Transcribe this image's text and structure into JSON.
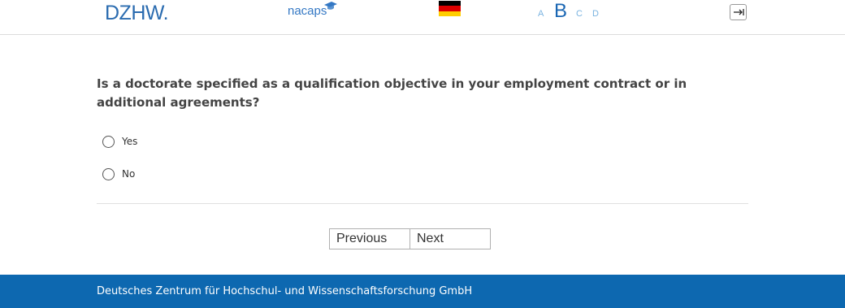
{
  "header": {
    "logo_dzhw": "DZHW.",
    "logo_nacaps": "nacaps",
    "language_flag": "german-flag",
    "font_sizes": [
      "A",
      "B",
      "C",
      "D"
    ],
    "active_font_size": "B",
    "logout_icon": "logout-arrow-icon"
  },
  "question": {
    "text": "Is a doctorate specified as a qualification objective in your employment contract or in additional agreements?",
    "options": [
      {
        "label": "Yes"
      },
      {
        "label": "No"
      }
    ]
  },
  "navigation": {
    "previous_label": "Previous",
    "next_label": "Next"
  },
  "footer": {
    "text": "Deutsches Zentrum für Hochschul- und Wissenschaftsforschung GmbH"
  },
  "colors": {
    "brand_blue": "#0d68b0",
    "logo_blue": "#2b6cb0",
    "font_size_inactive": "#7ab3e0"
  }
}
